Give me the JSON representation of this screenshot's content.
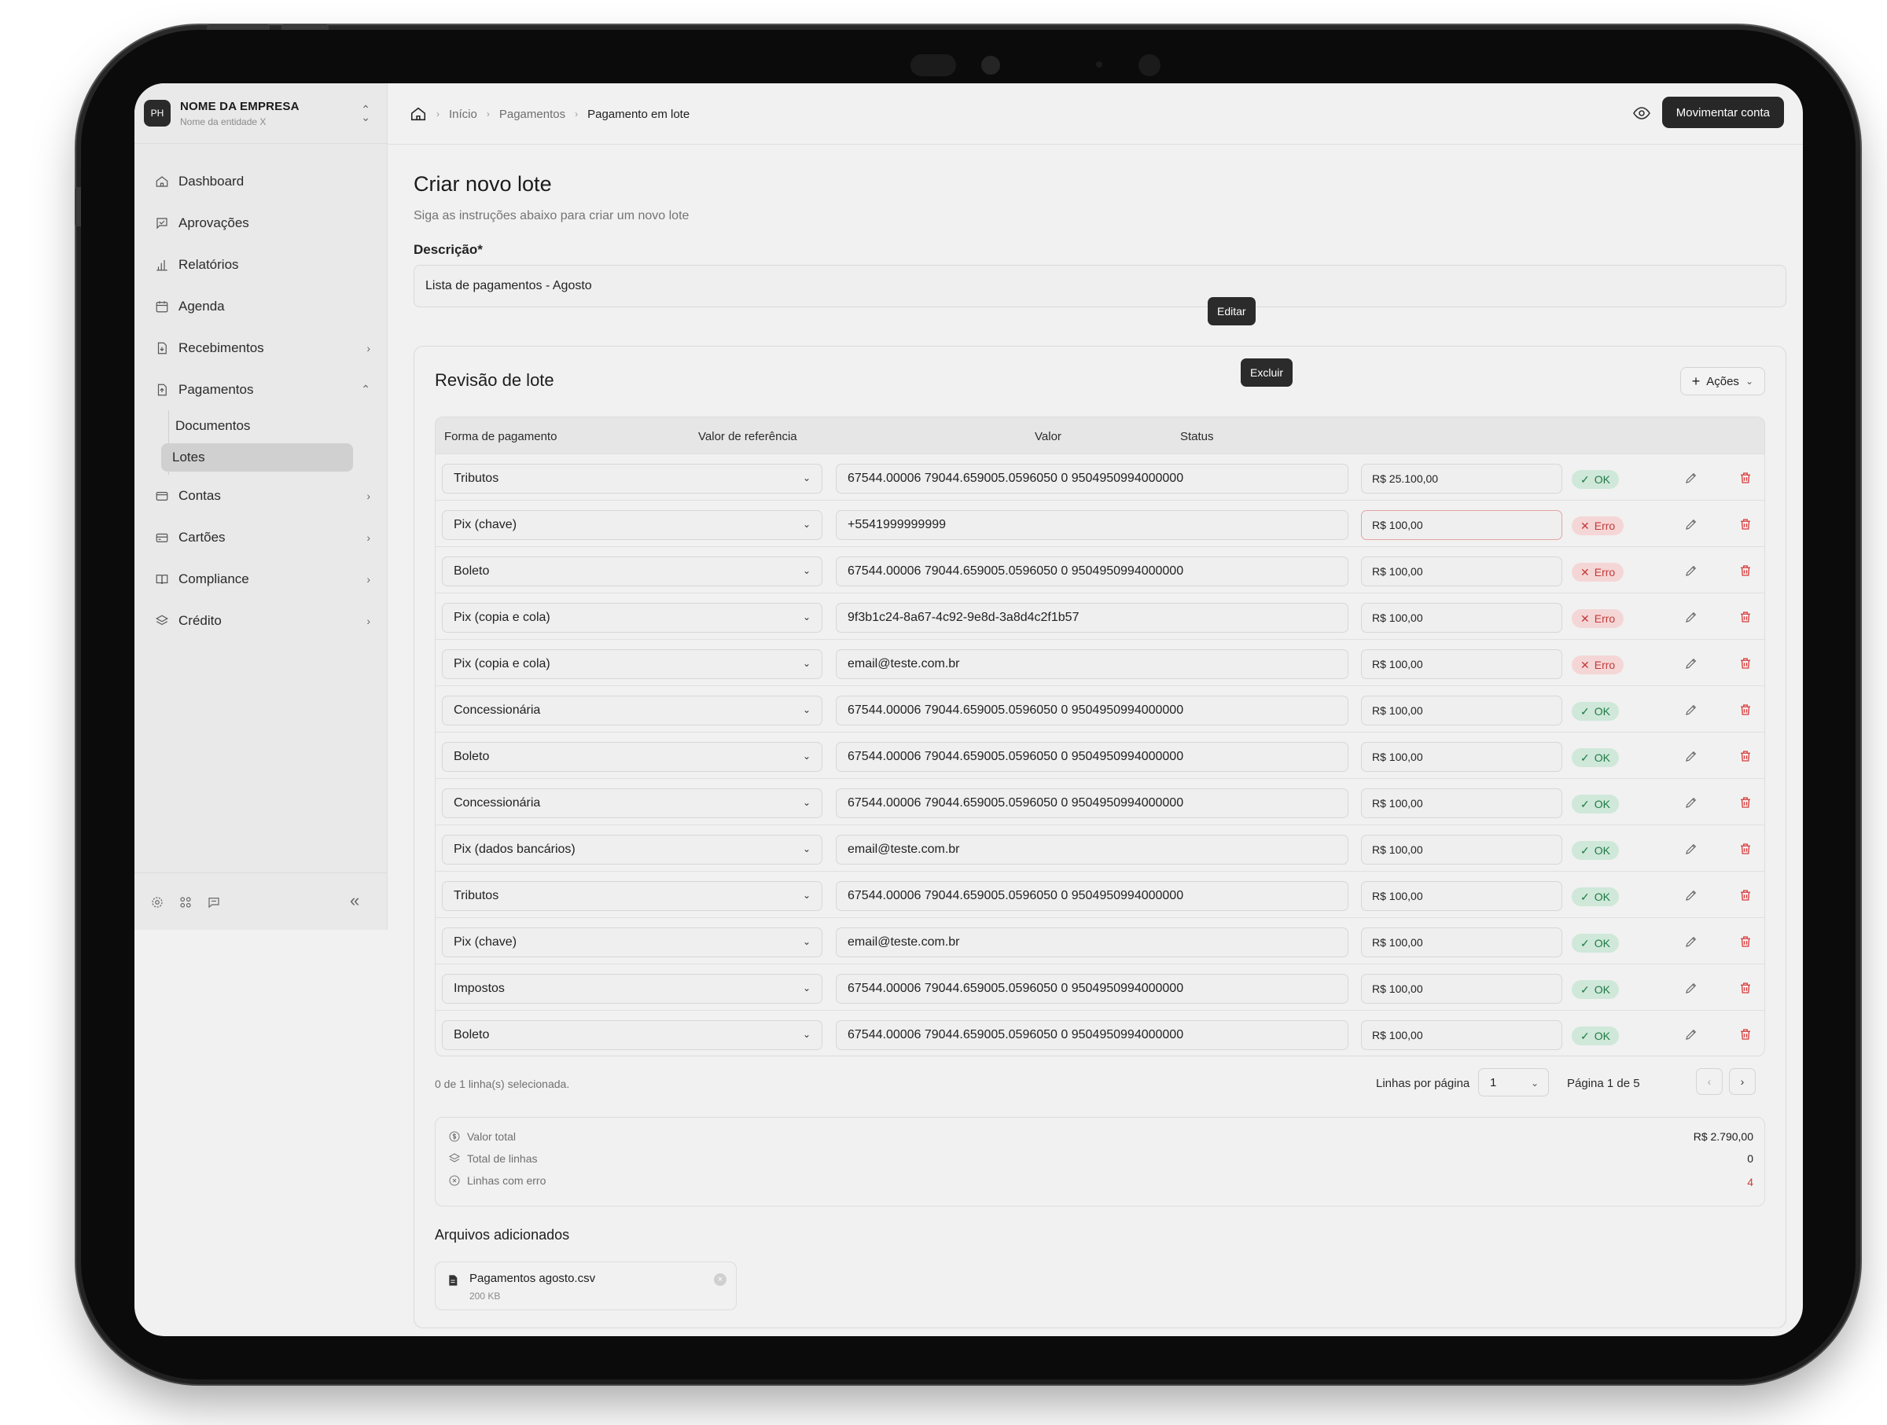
{
  "company": {
    "initials": "PH",
    "name": "NOME DA EMPRESA",
    "entity": "Nome da entidade X"
  },
  "sidebar": {
    "items": [
      {
        "label": "Dashboard",
        "icon": "home-icon"
      },
      {
        "label": "Aprovações",
        "icon": "approvals-icon"
      },
      {
        "label": "Relatórios",
        "icon": "bar-chart-icon"
      },
      {
        "label": "Agenda",
        "icon": "calendar-icon"
      },
      {
        "label": "Recebimentos",
        "icon": "receipt-icon"
      },
      {
        "label": "Pagamentos",
        "icon": "payment-file-icon"
      },
      {
        "label": "Contas",
        "icon": "wallet-icon"
      },
      {
        "label": "Cartões",
        "icon": "credit-card-icon"
      },
      {
        "label": "Compliance",
        "icon": "book-icon"
      },
      {
        "label": "Crédito",
        "icon": "layers-icon"
      }
    ],
    "sub_items": [
      "Documentos",
      "Lotes"
    ],
    "active_sub": "Lotes"
  },
  "breadcrumb": {
    "home": "home-icon",
    "items": [
      "Início",
      "Pagamentos",
      "Pagamento em lote"
    ]
  },
  "header": {
    "move_button": "Movimentar conta"
  },
  "page": {
    "title": "Criar novo lote",
    "subtitle": "Siga as instruções abaixo para criar um novo lote",
    "description_label": "Descrição*",
    "description_value": "Lista de pagamentos - Agosto"
  },
  "review": {
    "title": "Revisão de lote",
    "actions_label": "Ações",
    "columns": [
      "Forma de pagamento",
      "Valor de referência",
      "Valor",
      "Status"
    ],
    "tooltips": {
      "edit": "Editar",
      "delete": "Excluir"
    },
    "rows": [
      {
        "method": "Tributos",
        "reference": "67544.00006 79044.659005.0596050 0 9504950994000000",
        "value": "R$ 25.100,00",
        "status": "OK",
        "status_type": "ok"
      },
      {
        "method": "Pix (chave)",
        "reference": "+5541999999999",
        "value": "R$ 100,00",
        "status": "Erro",
        "status_type": "err"
      },
      {
        "method": "Boleto",
        "reference": "67544.00006 79044.659005.0596050 0 9504950994000000",
        "value": "R$ 100,00",
        "status": "Erro",
        "status_type": "err"
      },
      {
        "method": "Pix (copia e cola)",
        "reference": "9f3b1c24-8a67-4c92-9e8d-3a8d4c2f1b57",
        "value": "R$ 100,00",
        "status": "Erro",
        "status_type": "err"
      },
      {
        "method": "Pix (copia e cola)",
        "reference": "email@teste.com.br",
        "value": "R$ 100,00",
        "status": "Erro",
        "status_type": "err"
      },
      {
        "method": "Concessionária",
        "reference": "67544.00006 79044.659005.0596050 0 9504950994000000",
        "value": "R$ 100,00",
        "status": "OK",
        "status_type": "ok"
      },
      {
        "method": "Boleto",
        "reference": "67544.00006 79044.659005.0596050 0 9504950994000000",
        "value": "R$ 100,00",
        "status": "OK",
        "status_type": "ok"
      },
      {
        "method": "Concessionária",
        "reference": "67544.00006 79044.659005.0596050 0 9504950994000000",
        "value": "R$ 100,00",
        "status": "OK",
        "status_type": "ok"
      },
      {
        "method": "Pix (dados bancários)",
        "reference": "email@teste.com.br",
        "value": "R$ 100,00",
        "status": "OK",
        "status_type": "ok"
      },
      {
        "method": "Tributos",
        "reference": "67544.00006 79044.659005.0596050 0 9504950994000000",
        "value": "R$ 100,00",
        "status": "OK",
        "status_type": "ok"
      },
      {
        "method": "Pix (chave)",
        "reference": "email@teste.com.br",
        "value": "R$ 100,00",
        "status": "OK",
        "status_type": "ok"
      },
      {
        "method": "Impostos",
        "reference": "67544.00006 79044.659005.0596050 0 9504950994000000",
        "value": "R$ 100,00",
        "status": "OK",
        "status_type": "ok"
      },
      {
        "method": "Boleto",
        "reference": "67544.00006 79044.659005.0596050 0 9504950994000000",
        "value": "R$ 100,00",
        "status": "OK",
        "status_type": "ok"
      }
    ],
    "selection_info": "0 de 1 linha(s) selecionada.",
    "rows_per_page_label": "Linhas por página",
    "rows_per_page_value": "1",
    "page_info": "Página 1 de 5"
  },
  "summary": [
    {
      "label": "Valor total",
      "value": "R$ 2.790,00",
      "icon": "dollar-circle-icon"
    },
    {
      "label": "Total de linhas",
      "value": "0",
      "icon": "layers-icon"
    },
    {
      "label": "Linhas com erro",
      "value": "4",
      "icon": "x-circle-icon"
    }
  ],
  "files": {
    "title": "Arquivos adicionados",
    "items": [
      {
        "name": "Pagamentos agosto.csv",
        "size": "200 KB"
      }
    ]
  },
  "colors": {
    "ok_bg": "#cfe8d9",
    "ok_text": "#1f7a45",
    "err_bg": "#f5d6d6",
    "err_text": "#c23b3b",
    "primary_button": "#272727"
  }
}
